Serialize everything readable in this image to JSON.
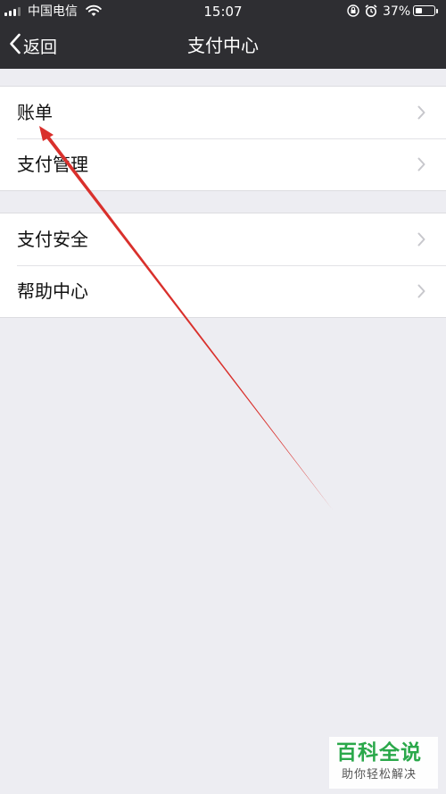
{
  "status_bar": {
    "carrier": "中国电信",
    "time": "15:07",
    "battery_percent": "37%",
    "battery_level": 0.37,
    "icons": [
      "signal-icon",
      "wifi-icon",
      "rotation-lock-icon",
      "alarm-icon",
      "battery-icon"
    ]
  },
  "nav": {
    "back_label": "返回",
    "title": "支付中心"
  },
  "groups": [
    {
      "items": [
        {
          "label": "账单",
          "icon": "chevron-right-icon"
        },
        {
          "label": "支付管理",
          "icon": "chevron-right-icon"
        }
      ]
    },
    {
      "items": [
        {
          "label": "支付安全",
          "icon": "chevron-right-icon"
        },
        {
          "label": "帮助中心",
          "icon": "chevron-right-icon"
        }
      ]
    }
  ],
  "annotation": {
    "type": "arrow",
    "color": "#d9302c",
    "points_to": "账单"
  },
  "watermark": {
    "title": "百科全说",
    "subtitle": "助你轻松解决"
  },
  "colors": {
    "header_bg": "#2e2e32",
    "page_bg": "#ededf2",
    "row_bg": "#ffffff",
    "chevron": "#c7c7cc",
    "watermark_green": "#2aa84a"
  }
}
